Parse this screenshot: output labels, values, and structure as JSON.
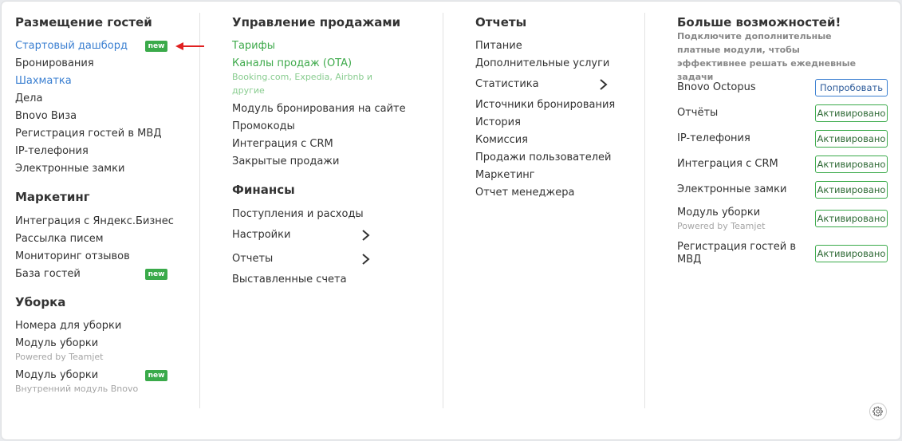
{
  "col1": {
    "heading1": "Размещение гостей",
    "items1": [
      "Стартовый дашборд",
      "Бронирования",
      "Шахматка",
      "Дела",
      "Bnovo Виза",
      "Регистрация гостей в МВД",
      "IP-телефония",
      "Электронные замки"
    ],
    "heading2": "Маркетинг",
    "items2": [
      "Интеграция с Яндекс.Бизнес",
      "Рассылка писем",
      "Мониторинг отзывов",
      "База гостей"
    ],
    "heading3": "Уборка",
    "items3": [
      "Номера для уборки",
      "Модуль уборки",
      "Модуль уборки"
    ],
    "sub_teamjet": "Powered by Teamjet",
    "sub_internal": "Внутренний модуль Bnovo",
    "badge": "new"
  },
  "col2": {
    "heading1": "Управление продажами",
    "tariffs": "Тарифы",
    "ota": "Каналы продаж (OTA)",
    "ota_sub1": "Booking.com, Expedia, Airbnb и",
    "ota_sub2": "другие",
    "items1": [
      "Модуль бронирования на сайте",
      "Промокоды",
      "Интеграция с CRM",
      "Закрытые продажи"
    ],
    "heading2": "Финансы",
    "items2": [
      "Поступления и расходы",
      "Настройки",
      "Отчеты",
      "Выставленные счета"
    ]
  },
  "col3": {
    "heading": "Отчеты",
    "items": [
      "Питание",
      "Дополнительные услуги",
      "Статистика",
      "Источники бронирования",
      "История",
      "Комиссия",
      "Продажи пользователей",
      "Маркетинг",
      "Отчет менеджера"
    ]
  },
  "col4": {
    "heading": "Больше возможностей!",
    "desc": "Подключите дополнительные платные модули, чтобы эффективнее решать ежедневные задачи",
    "rows": [
      {
        "label": "Bnovo Octopus",
        "button": "Попробовать"
      },
      {
        "label": "Отчёты",
        "button": "Активировано"
      },
      {
        "label": "IP-телефония",
        "button": "Активировано"
      },
      {
        "label": "Интеграция с CRM",
        "button": "Активировано"
      },
      {
        "label": "Электронные замки",
        "button": "Активировано"
      },
      {
        "label": "Модуль уборки",
        "button": "Активировано"
      },
      {
        "label": "Регистрация гостей в",
        "button": "Активировано"
      }
    ],
    "cleaning_sub": "Powered by Teamjet",
    "mvd_line2": "МВД"
  },
  "colors": {
    "link_blue": "#3a7fd1",
    "green": "#3faa4c",
    "badge_green": "#3aaa4a",
    "arrow_red": "#e02020"
  },
  "icons": {
    "submenu": "chevron-right-icon",
    "settings": "gear-icon",
    "pointer": "red-arrow-icon"
  }
}
